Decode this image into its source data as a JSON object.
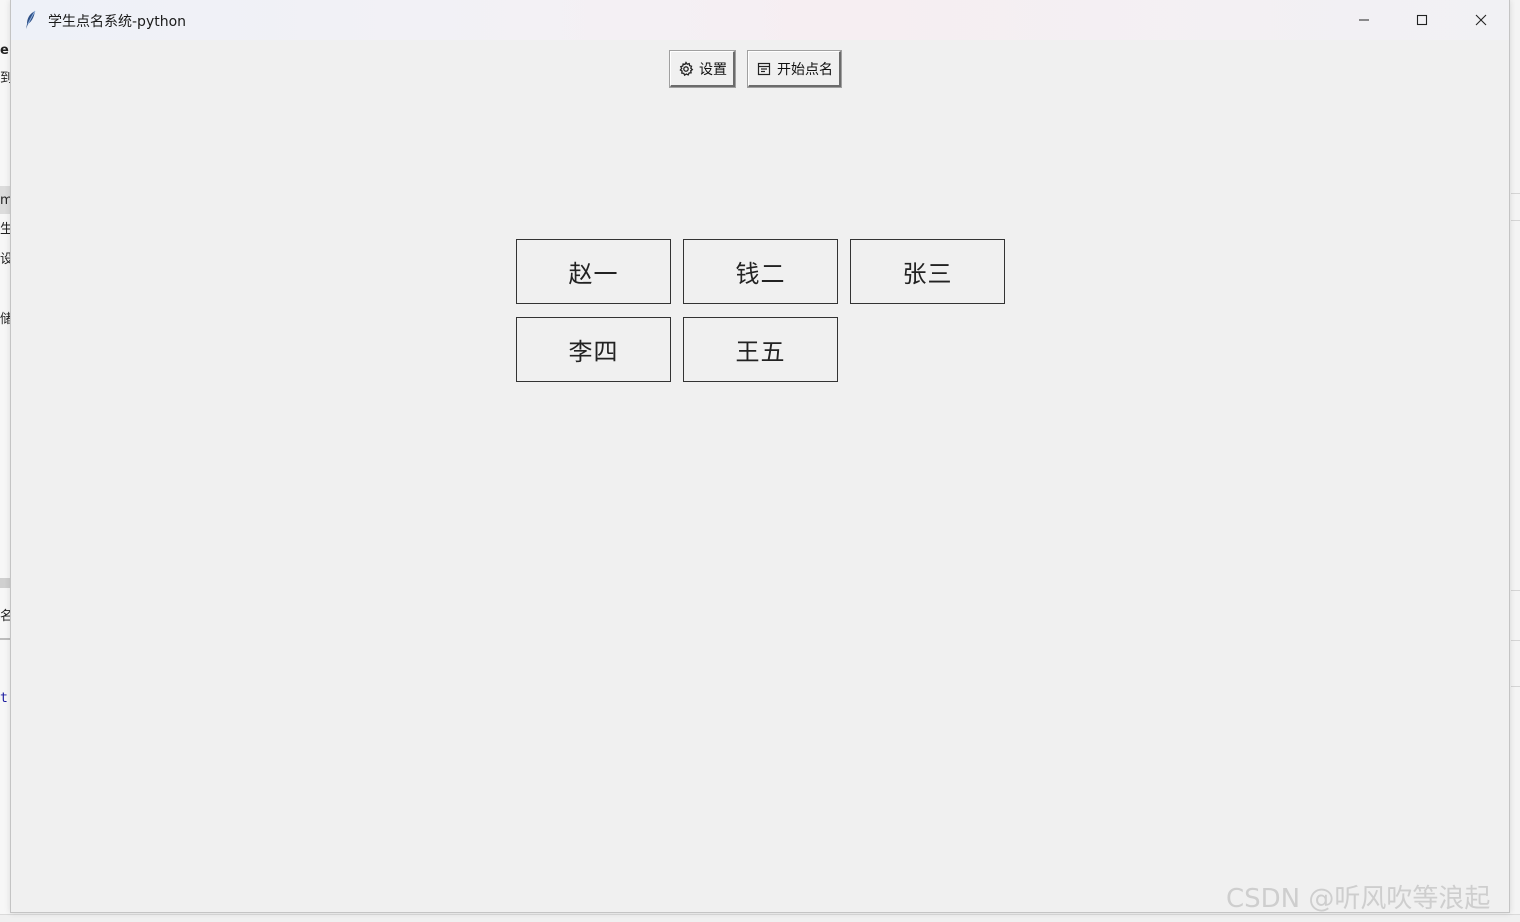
{
  "window": {
    "title": "学生点名系统-python",
    "controls": {
      "minimize_icon": "minimize-icon",
      "maximize_icon": "maximize-icon",
      "close_icon": "close-icon"
    }
  },
  "toolbar": {
    "settings_label": "设置",
    "settings_icon": "gear-icon",
    "start_label": "开始点名",
    "start_icon": "roster-icon"
  },
  "students": [
    {
      "name": "赵一"
    },
    {
      "name": "钱二"
    },
    {
      "name": "张三"
    },
    {
      "name": "李四"
    },
    {
      "name": "王五"
    }
  ],
  "watermark": "CSDN @听风吹等浪起",
  "colors": {
    "window_bg": "#f0f0f0",
    "border": "#333333",
    "text": "#222222"
  }
}
